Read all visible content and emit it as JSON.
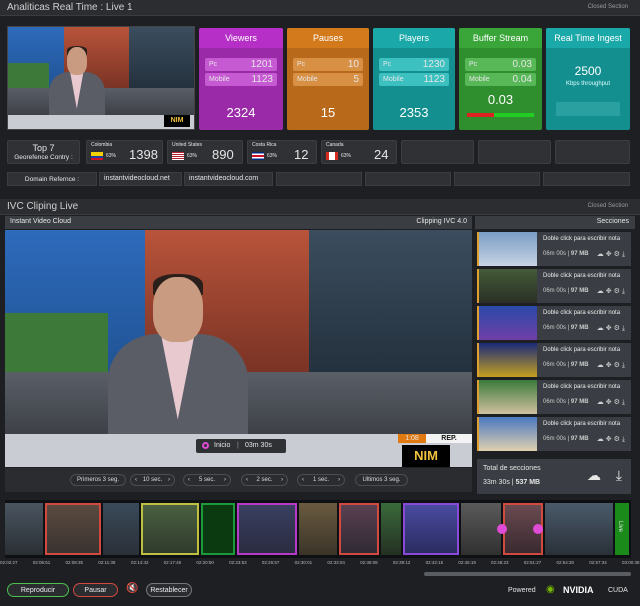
{
  "analytics": {
    "title": "Analiticas Real Time : Live 1",
    "closed_label": "Closed Section",
    "metrics": [
      {
        "title": "Viewers",
        "pc_label": "Pc",
        "pc": "1201",
        "mobile_label": "Mobile",
        "mobile": "1123",
        "total": "2324",
        "color": "#b630c7"
      },
      {
        "title": "Pauses",
        "pc_label": "Pc",
        "pc": "10",
        "mobile_label": "Mobile",
        "mobile": "5",
        "total": "15",
        "color": "#d37a1d"
      },
      {
        "title": "Players",
        "pc_label": "Pc",
        "pc": "1230",
        "mobile_label": "Mobile",
        "mobile": "1123",
        "total": "2353",
        "color": "#1aa8a8"
      },
      {
        "title": "Buffer Stream",
        "pc_label": "Pc",
        "pc": "0.03",
        "mobile_label": "Mobile",
        "mobile": "0.04",
        "total": "0.03",
        "color": "#3aa63a"
      },
      {
        "title": "Real Time Ingest",
        "value": "2500",
        "unit": "Kbps throughput",
        "color": "#1aa8a8"
      }
    ],
    "top": {
      "title": "Top 7",
      "subtitle": "Georefence Contry :"
    },
    "countries": [
      {
        "name": "Colombia",
        "pct": "63%",
        "value": "1398"
      },
      {
        "name": "United States",
        "pct": "63%",
        "value": "890"
      },
      {
        "name": "Costa Rica",
        "pct": "63%",
        "value": "12"
      },
      {
        "name": "Canada",
        "pct": "63%",
        "value": "24"
      }
    ],
    "domain_label": "Domain Refernce :",
    "domains": [
      "instantvideocloud.net",
      "instantvideocloud.com"
    ]
  },
  "clipping": {
    "title": "IVC  Cliping Live",
    "closed_label": "Closed Section",
    "brand": "Instant Video Cloud",
    "version": "Clipping IVC 4.0",
    "sections_label": "Secciones",
    "inicio_label": "Inicio",
    "inicio_time": "03m 30s",
    "live_time": "1:08",
    "live_tag": "REP.",
    "logo": "NIM",
    "nav_buttons": [
      "Primeros 3 seg.",
      "10 sec.",
      "5 sec.",
      "2 sec.",
      "1 sec.",
      "Ultimos 3 seg."
    ],
    "sections": [
      {
        "note": "Doble click para escribir nota",
        "dur": "06m 00s",
        "size": "97 MB"
      },
      {
        "note": "Doble click para escribir nota",
        "dur": "06m 00s",
        "size": "97 MB"
      },
      {
        "note": "Doble click para escribir nota",
        "dur": "06m 00s",
        "size": "97 MB"
      },
      {
        "note": "Doble click para escribir nota",
        "dur": "06m 00s",
        "size": "97 MB"
      },
      {
        "note": "Doble click para escribir nota",
        "dur": "06m 00s",
        "size": "97 MB"
      },
      {
        "note": "Doble click para escribir nota",
        "dur": "06m 00s",
        "size": "97 MB"
      }
    ],
    "total_label": "Total de secciones",
    "total_dur": "33m 30s",
    "total_size": "537 MB",
    "live_strip_label": "Live",
    "timeline": [
      "02:02:27",
      "02:06:51",
      "02:08:35",
      "02:11:39",
      "02:14:42",
      "02:17:46",
      "02:20:50",
      "02:23:53",
      "02:26:57",
      "02:30:01",
      "02:33:04",
      "02:36:08",
      "02:39:12",
      "02:42:15",
      "02:45:19",
      "02:48:23",
      "02:51:27",
      "02:54:30",
      "02:57:34",
      "03:00:38"
    ],
    "controls": {
      "play": "Reproducir",
      "pause": "Pausar",
      "reset": "Restablecer"
    },
    "powered": "Powered",
    "nvidia": "NVIDIA",
    "cuda": "CUDA"
  }
}
